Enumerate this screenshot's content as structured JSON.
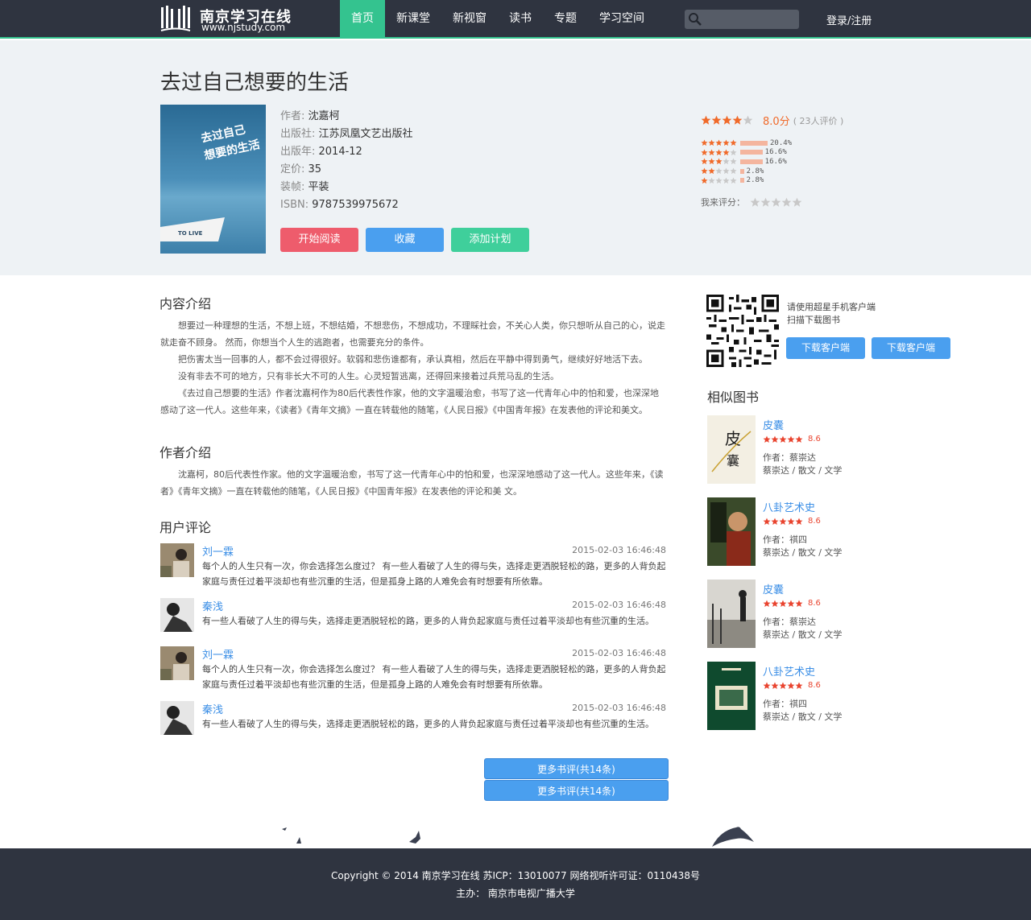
{
  "header": {
    "logo_title": "南京学习在线",
    "logo_url": "www.njstudy.com",
    "nav": [
      "首页",
      "新课堂",
      "新视窗",
      "读书",
      "专题",
      "学习空间"
    ],
    "search_placeholder": "",
    "login": "登录/注册"
  },
  "book": {
    "title": "去过自己想要的生活",
    "cover_title_1": "去过自己",
    "cover_title_2": "想要的生活",
    "cover_tag": "TO LIVE",
    "meta": [
      {
        "k": "作者: ",
        "v": "沈嘉柯"
      },
      {
        "k": "出版社: ",
        "v": "江苏凤凰文艺出版社"
      },
      {
        "k": "出版年: ",
        "v": "2014-12"
      },
      {
        "k": "定价: ",
        "v": "35"
      },
      {
        "k": "装帧: ",
        "v": "平装"
      },
      {
        "k": "ISBN: ",
        "v": "9787539975672"
      }
    ],
    "buttons": {
      "read": "开始阅读",
      "fav": "收藏",
      "plan": "添加计划"
    }
  },
  "rating": {
    "stars": 4,
    "score": "8.0分",
    "count": "( 23人评价 )",
    "distribution": [
      {
        "stars": 5,
        "pct": "20.4%",
        "value": 20.4
      },
      {
        "stars": 4,
        "pct": "16.6%",
        "value": 16.6
      },
      {
        "stars": 3,
        "pct": "16.6%",
        "value": 16.6
      },
      {
        "stars": 2,
        "pct": "2.8%",
        "value": 2.8
      },
      {
        "stars": 1,
        "pct": "2.8%",
        "value": 2.8
      }
    ],
    "my_rate_label": "我来评分：",
    "colors": {
      "star_on": "#f06a2a",
      "star_off": "#c8c8c8",
      "bar": "#f4b59e"
    }
  },
  "intro": {
    "heading": "内容介绍",
    "paragraphs": [
      "想要过一种理想的生活，不想上班，不想结婚，不想悲伤，不想成功，不理睬社会，不关心人类，你只想听从自己的心，说走就走奋不顾身。 然而，你想当个人生的逃跑者，也需要充分的条件。",
      "把伤害太当一回事的人，都不会过得很好。软弱和悲伤谁都有，承认真相，然后在平静中得到勇气，继续好好地活下去。",
      "没有非去不可的地方，只有非长大不可的人生。心灵短暂逃离，还得回来接着过兵荒马乱的生活。",
      "《去过自己想要的生活》作者沈嘉柯作为80后代表性作家，他的文字温暖治愈，书写了这一代青年心中的怕和爱，也深深地感动了这一代人。这些年来，《读者》《青年文摘》一直在转载他的随笔，《人民日报》《中国青年报》在发表他的评论和美文。"
    ]
  },
  "author": {
    "heading": "作者介绍",
    "paragraph": "沈嘉柯，80后代表性作家。他的文字温暖治愈，书写了这一代青年心中的怕和爱，也深深地感动了这一代人。这些年来，《读者》《青年文摘》一直在转载他的随笔，《人民日报》《中国青年报》在发表他的评论和美 文。"
  },
  "comments": {
    "heading": "用户评论",
    "items": [
      {
        "user": "刘一霖",
        "time": "2015-02-03 16:46:48",
        "text": "每个人的人生只有一次，你会选择怎么度过？ 有一些人看破了人生的得与失，选择走更洒脱轻松的路，更多的人背负起家庭与责任过着平淡却也有些沉重的生活，但是孤身上路的人难免会有时想要有所依靠。"
      },
      {
        "user": "秦浅",
        "time": "2015-02-03 16:46:48",
        "text": "有一些人看破了人生的得与失，选择走更洒脱轻松的路，更多的人背负起家庭与责任过着平淡却也有些沉重的生活。"
      },
      {
        "user": "刘一霖",
        "time": "2015-02-03 16:46:48",
        "text": "每个人的人生只有一次，你会选择怎么度过？ 有一些人看破了人生的得与失，选择走更洒脱轻松的路，更多的人背负起家庭与责任过着平淡却也有些沉重的生活，但是孤身上路的人难免会有时想要有所依靠。"
      },
      {
        "user": "秦浅",
        "time": "2015-02-03 16:46:48",
        "text": "有一些人看破了人生的得与失，选择走更洒脱轻松的路，更多的人背负起家庭与责任过着平淡却也有些沉重的生活。"
      }
    ],
    "more": [
      "更多书评(共14条)",
      "更多书评(共14条)"
    ]
  },
  "sidebar": {
    "qr_hint_1": "请使用超星手机客户端",
    "qr_hint_2": "扫描下载图书",
    "download": [
      "下载客户端",
      "下载客户端"
    ],
    "similar_heading": "相似图书",
    "similar": [
      {
        "title": "皮囊",
        "score": "8.6",
        "author": "作者：蔡崇达",
        "tags": "蔡崇达 / 散文 / 文学"
      },
      {
        "title": "八卦艺术史",
        "score": "8.6",
        "author": "作者：祺四",
        "tags": "蔡崇达 / 散文 / 文学"
      },
      {
        "title": "皮囊",
        "score": "8.6",
        "author": "作者：蔡崇达",
        "tags": "蔡崇达 / 散文 / 文学"
      },
      {
        "title": "八卦艺术史",
        "score": "8.6",
        "author": "作者：祺四",
        "tags": "蔡崇达 / 散文 / 文学"
      }
    ]
  },
  "footer": {
    "line1": "Copyright © 2014 南京学习在线   苏ICP：13010077   网络视听许可证：0110438号",
    "line2": "主办：  南京市电视广播大学"
  }
}
